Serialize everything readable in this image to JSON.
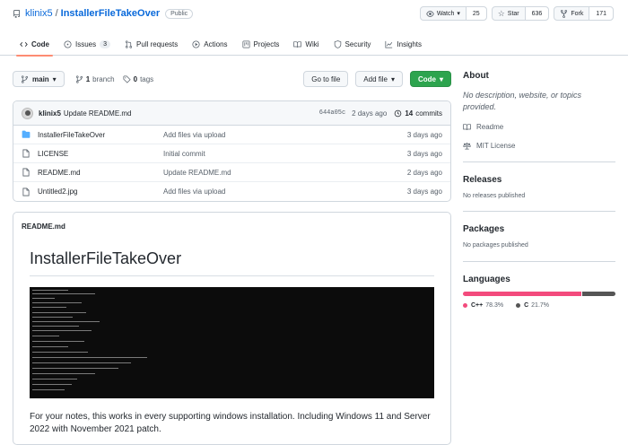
{
  "repo": {
    "owner": "klinix5",
    "separator": "/",
    "name": "InstallerFileTakeOver",
    "visibility": "Public"
  },
  "actions": {
    "watch": {
      "label": "Watch",
      "count": "25"
    },
    "star": {
      "label": "Star",
      "count": "636"
    },
    "fork": {
      "label": "Fork",
      "count": "171"
    }
  },
  "tabs": [
    {
      "label": "Code",
      "icon": "code-icon"
    },
    {
      "label": "Issues",
      "icon": "issue-icon",
      "count": "3"
    },
    {
      "label": "Pull requests",
      "icon": "pull-request-icon"
    },
    {
      "label": "Actions",
      "icon": "play-icon"
    },
    {
      "label": "Projects",
      "icon": "project-icon"
    },
    {
      "label": "Wiki",
      "icon": "book-icon"
    },
    {
      "label": "Security",
      "icon": "shield-icon"
    },
    {
      "label": "Insights",
      "icon": "graph-icon"
    }
  ],
  "toolbar": {
    "branch": "main",
    "branches_count": "1",
    "branches_label": "branch",
    "tags_count": "0",
    "tags_label": "tags",
    "goto_file": "Go to file",
    "add_file": "Add file",
    "code": "Code"
  },
  "commit": {
    "author": "klinix5",
    "message": "Update README.md",
    "sha": "644a05c",
    "ago": "2 days ago",
    "count": "14",
    "count_label": "commits"
  },
  "files": [
    {
      "type": "folder",
      "name": "InstallerFileTakeOver",
      "message": "Add files via upload",
      "date": "3 days ago"
    },
    {
      "type": "file",
      "name": "LICENSE",
      "message": "Initial commit",
      "date": "3 days ago"
    },
    {
      "type": "file",
      "name": "README.md",
      "message": "Update README.md",
      "date": "2 days ago"
    },
    {
      "type": "file",
      "name": "Untitled2.jpg",
      "message": "Add files via upload",
      "date": "3 days ago"
    }
  ],
  "readme": {
    "header": "README.md",
    "title": "InstallerFileTakeOver",
    "paragraph": "For your notes, this works in every supporting windows installation. Including Windows 11 and Server 2022 with November 2021 patch."
  },
  "sidebar": {
    "about": {
      "title": "About",
      "description": "No description, website, or topics provided.",
      "readme": "Readme",
      "license": "MIT License"
    },
    "releases": {
      "title": "Releases",
      "text": "No releases published"
    },
    "packages": {
      "title": "Packages",
      "text": "No packages published"
    },
    "languages": {
      "title": "Languages",
      "items": [
        {
          "name": "C++",
          "percent": "78.3%",
          "value": 78.3,
          "color": "#f34b7d"
        },
        {
          "name": "C",
          "percent": "21.7%",
          "value": 21.7,
          "color": "#555555"
        }
      ]
    }
  },
  "colors": {
    "accent": "#0969da",
    "green": "#2da44e",
    "tab_underline": "#fd8c73"
  }
}
